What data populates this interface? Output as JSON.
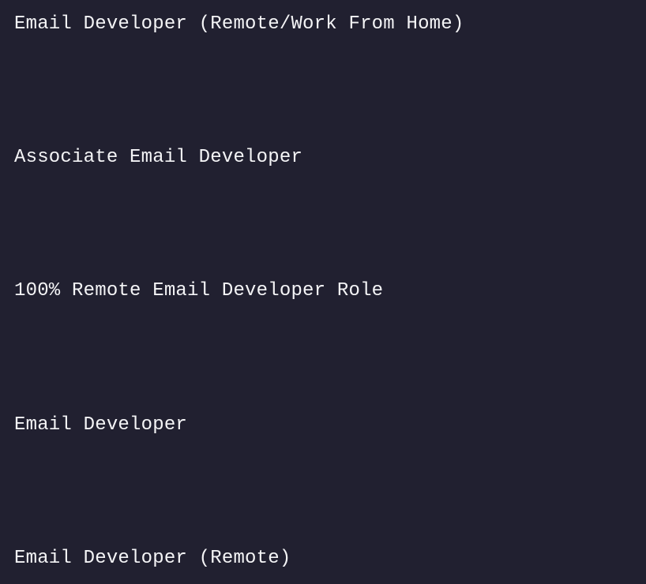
{
  "jobs": [
    {
      "title": "Email Developer (Remote/Work From Home)"
    },
    {
      "title": "Associate Email Developer"
    },
    {
      "title": "100% Remote Email Developer Role"
    },
    {
      "title": "Email Developer"
    },
    {
      "title": "Email Developer (Remote)"
    }
  ]
}
